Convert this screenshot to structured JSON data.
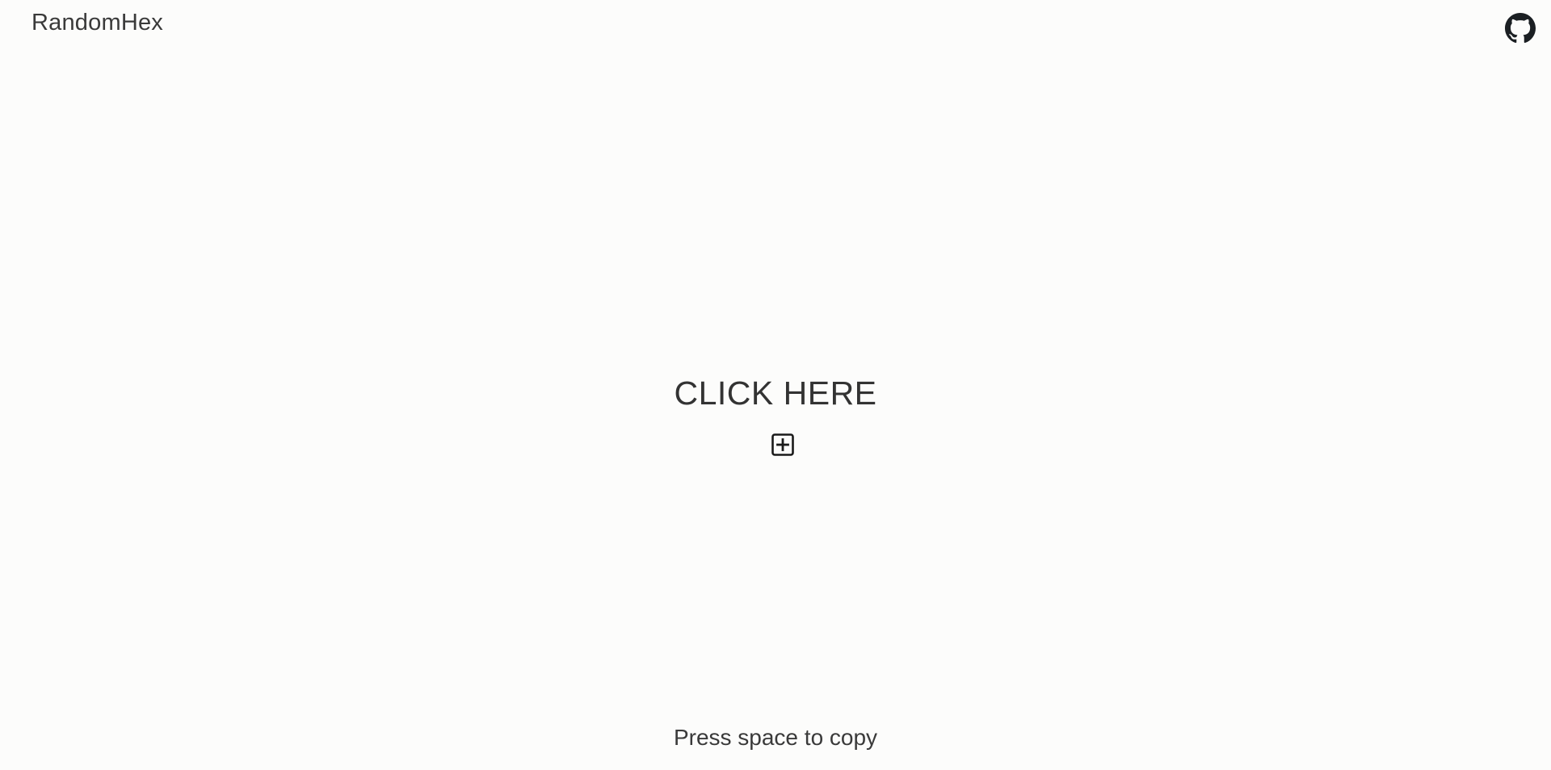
{
  "header": {
    "brand": "RandomHex",
    "github_icon": "github-icon"
  },
  "main": {
    "cta_label": "CLICK HERE",
    "cta_icon": "plus-square-icon"
  },
  "footer": {
    "hint": "Press space to copy"
  },
  "colors": {
    "background": "#fcfcfb",
    "text": "#333333"
  }
}
